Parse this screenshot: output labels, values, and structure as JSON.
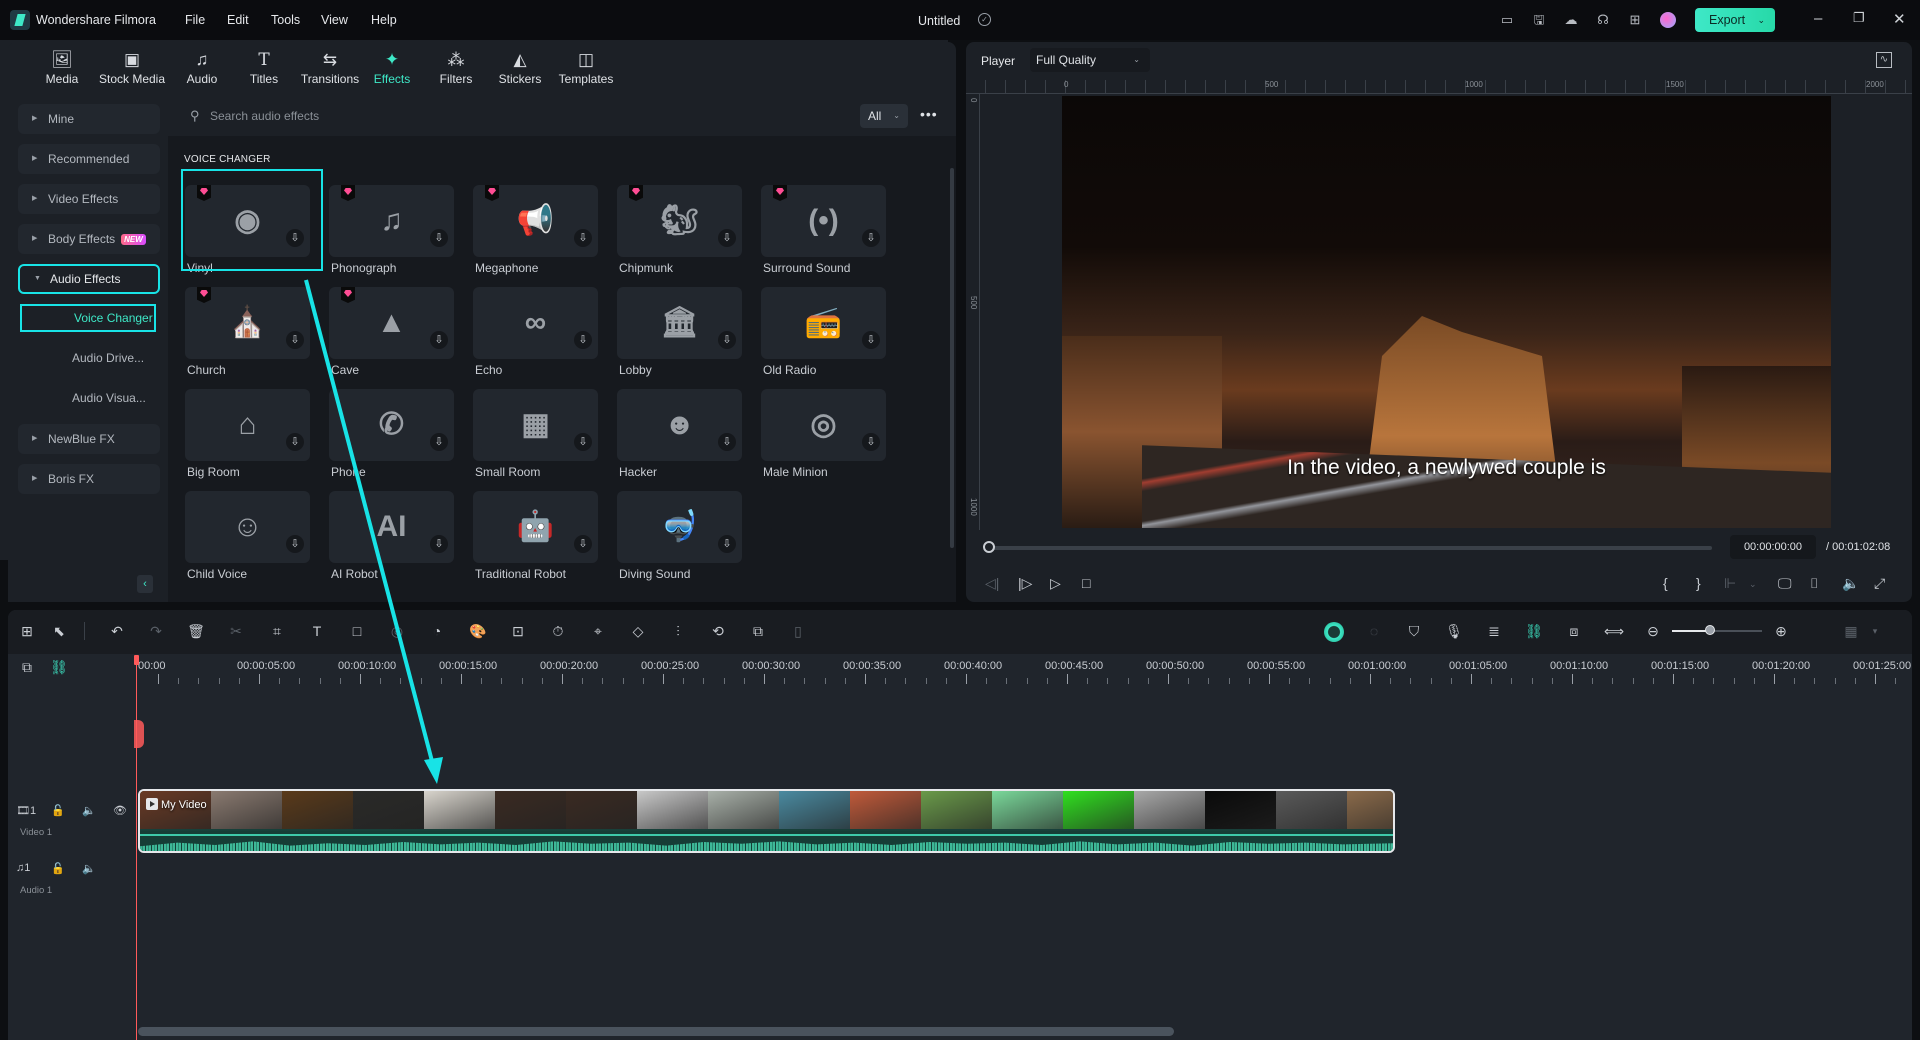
{
  "app": {
    "name": "Wondershare Filmora",
    "document_title": "Untitled",
    "menu": [
      "File",
      "Edit",
      "Tools",
      "View",
      "Help"
    ],
    "export_label": "Export",
    "accent_color": "#3ee8c7",
    "highlight_color": "#18e3e6"
  },
  "top_tabs": [
    {
      "label": "Media",
      "icon": "media-icon"
    },
    {
      "label": "Stock Media",
      "icon": "stock-media-icon"
    },
    {
      "label": "Audio",
      "icon": "music-note-icon"
    },
    {
      "label": "Titles",
      "icon": "title-t-icon"
    },
    {
      "label": "Transitions",
      "icon": "transitions-icon"
    },
    {
      "label": "Effects",
      "icon": "sparkle-star-icon",
      "active": true
    },
    {
      "label": "Filters",
      "icon": "filters-icon"
    },
    {
      "label": "Stickers",
      "icon": "stickers-icon"
    },
    {
      "label": "Templates",
      "icon": "templates-icon"
    }
  ],
  "sidebar": {
    "items": [
      {
        "label": "Mine"
      },
      {
        "label": "Recommended"
      },
      {
        "label": "Video Effects"
      },
      {
        "label": "Body Effects",
        "badge": "NEW"
      },
      {
        "label": "Audio Effects",
        "expanded": true,
        "selected": true
      },
      {
        "label": "NewBlue FX"
      },
      {
        "label": "Boris FX"
      }
    ],
    "subitems": [
      {
        "label": "Voice Changer",
        "selected": true
      },
      {
        "label": "Audio Drive..."
      },
      {
        "label": "Audio Visua..."
      }
    ]
  },
  "search": {
    "placeholder": "Search audio effects",
    "value": "",
    "filter": "All"
  },
  "section_title": "VOICE CHANGER",
  "effects": [
    {
      "name": "Vinyl",
      "glyph": "◉",
      "premium": true,
      "icon": "vinyl-record-icon"
    },
    {
      "name": "Phonograph",
      "glyph": "♫",
      "premium": true,
      "icon": "phonograph-icon"
    },
    {
      "name": "Megaphone",
      "glyph": "📢",
      "premium": true,
      "icon": "megaphone-icon"
    },
    {
      "name": "Chipmunk",
      "glyph": "🐿",
      "premium": true,
      "icon": "squirrel-icon"
    },
    {
      "name": "Surround Sound",
      "glyph": "(•)",
      "premium": true,
      "icon": "surround-speaker-icon"
    },
    {
      "name": "Church",
      "glyph": "⛪",
      "premium": true,
      "icon": "church-icon"
    },
    {
      "name": "Cave",
      "glyph": "▲",
      "premium": true,
      "icon": "cave-icon"
    },
    {
      "name": "Echo",
      "glyph": "∞",
      "premium": false,
      "icon": "infinity-icon"
    },
    {
      "name": "Lobby",
      "glyph": "🏛",
      "premium": false,
      "icon": "building-columns-icon"
    },
    {
      "name": "Old Radio",
      "glyph": "📻",
      "premium": false,
      "icon": "radio-icon"
    },
    {
      "name": "Big Room",
      "glyph": "⌂",
      "premium": false,
      "icon": "house-icon"
    },
    {
      "name": "Phone",
      "glyph": "✆",
      "premium": false,
      "icon": "phone-icon"
    },
    {
      "name": "Small Room",
      "glyph": "▦",
      "premium": false,
      "icon": "small-house-icon"
    },
    {
      "name": "Hacker",
      "glyph": "☻",
      "premium": false,
      "icon": "mask-icon"
    },
    {
      "name": "Male Minion",
      "glyph": "◎",
      "premium": false,
      "icon": "minion-icon"
    },
    {
      "name": "Child Voice",
      "glyph": "☺",
      "premium": false,
      "icon": "baby-face-icon"
    },
    {
      "name": "AI Robot",
      "glyph": "AI",
      "premium": false,
      "icon": "ai-head-icon"
    },
    {
      "name": "Traditional Robot",
      "glyph": "🤖",
      "premium": false,
      "icon": "robot-icon"
    },
    {
      "name": "Diving Sound",
      "glyph": "🤿",
      "premium": false,
      "icon": "diving-mask-icon"
    }
  ],
  "player": {
    "label": "Player",
    "quality": "Full Quality",
    "ruler_h": [
      "0",
      "500",
      "1000",
      "1500",
      "2000"
    ],
    "ruler_v": [
      "0",
      "500",
      "1000"
    ],
    "subtitle": "In the video, a newlywed couple is",
    "current_time": "00:00:00:00",
    "total_time": "/ 00:01:02:08",
    "progress": 0
  },
  "timeline": {
    "ticks": [
      "00:00",
      "00:00:05:00",
      "00:00:10:00",
      "00:00:15:00",
      "00:00:20:00",
      "00:00:25:00",
      "00:00:30:00",
      "00:00:35:00",
      "00:00:40:00",
      "00:00:45:00",
      "00:00:50:00",
      "00:00:55:00",
      "00:01:00:00",
      "00:01:05:00",
      "00:01:10:00",
      "00:01:15:00",
      "00:01:20:00",
      "00:01:25:00"
    ],
    "tracks": [
      {
        "label": "Video 1",
        "index": "1"
      },
      {
        "label": "Audio 1",
        "index": "1"
      }
    ],
    "clip_title": "My Video",
    "zoom_level": 0.42
  },
  "annotation": {
    "arrow_color": "#18e3e6"
  }
}
